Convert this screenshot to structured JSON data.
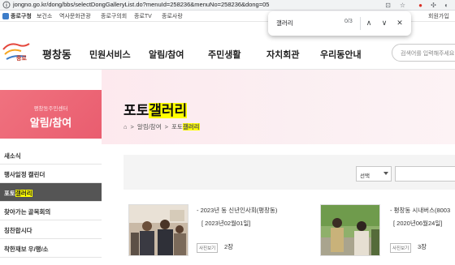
{
  "browser": {
    "url": "jongno.go.kr/dong/bbs/selectDongGalleryList.do?menuId=258236&menuNo=258236&dong=05",
    "bookmarks": [
      "종로구청",
      "보건소",
      "역사문화관광",
      "종로구의회",
      "종로TV",
      "종로사랑",
      "회원가입"
    ],
    "find": {
      "query": "갤러리",
      "count": "0/3"
    }
  },
  "site": {
    "logo_text": "종로",
    "title": "평창동",
    "nav": [
      "민원서비스",
      "알림/참여",
      "주민생활",
      "자치회관",
      "우리동안내"
    ],
    "search_placeholder": "검색어를 입력해주세요"
  },
  "sidebar": {
    "subtitle": "평창동주민센터",
    "title": "알림/참여",
    "items": [
      {
        "label": "새소식"
      },
      {
        "label": "행사일정 캘린더"
      },
      {
        "label_pre": "포토",
        "label_hl": "갤러리"
      },
      {
        "label": "찾아가는 골목회의"
      },
      {
        "label": "칭찬합시다"
      },
      {
        "label": "착한재보 우/행/소"
      }
    ]
  },
  "content": {
    "title_pre": "포토",
    "title_hl": "갤러리",
    "breadcrumb": {
      "home_icon": "home-icon",
      "b1": "알림/참여",
      "b2_pre": "포토",
      "b2_hl": "갤러리"
    },
    "filter": {
      "select_label": "선택"
    },
    "cards": [
      {
        "title": "- 2023년 동 신년인사회(평창동)",
        "date": "[ 2023년02월01일]",
        "badge": "사진보기",
        "count": "2장"
      },
      {
        "title": "- 평창동 시내버스(8003",
        "date": "[ 2020년06월24일]",
        "badge": "사진보기",
        "count": "3장"
      }
    ]
  },
  "colors": {
    "accent": "#e95d6f",
    "highlight": "#ffff00"
  }
}
